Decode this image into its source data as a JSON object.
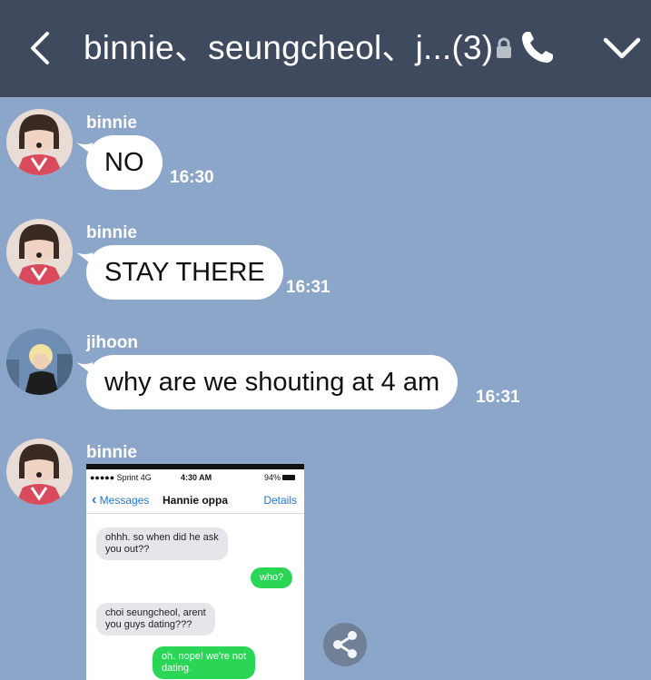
{
  "header": {
    "title": "binnie、seungcheol、j...(3)",
    "bg_color": "#3f4a5e"
  },
  "icons": {
    "back": "back-icon",
    "lock": "lock-icon",
    "phone": "phone-icon",
    "collapse": "chevron-down-icon",
    "share": "share-icon"
  },
  "messages": [
    {
      "sender": "binnie",
      "text": "NO",
      "time": "16:30"
    },
    {
      "sender": "binnie",
      "text": "STAY THERE",
      "time": "16:31"
    },
    {
      "sender": "jihoon",
      "text": "why are we shouting at 4 am",
      "time": "16:31"
    },
    {
      "sender": "binnie"
    }
  ],
  "screenshot": {
    "status": {
      "carrier": "●●●●● Sprint 4G",
      "clock": "4:30 AM",
      "battery": "94%"
    },
    "nav": {
      "back": "Messages",
      "title": "Hannie oppa",
      "details": "Details"
    },
    "bubbles": [
      {
        "dir": "in",
        "lines": [
          "ohhh. so when did he ask",
          "you out??"
        ]
      },
      {
        "dir": "out",
        "lines": [
          "who?"
        ]
      },
      {
        "dir": "in",
        "lines": [
          "choi seungcheol, arent",
          "you guys dating???"
        ]
      },
      {
        "dir": "out",
        "lines": [
          "oh. nope! we're not",
          "dating."
        ]
      }
    ]
  },
  "colors": {
    "chat_bg": "#8ca6c9",
    "bubble": "#ffffff",
    "ios_blue": "#1f78e0",
    "ios_green": "#2bd657"
  }
}
